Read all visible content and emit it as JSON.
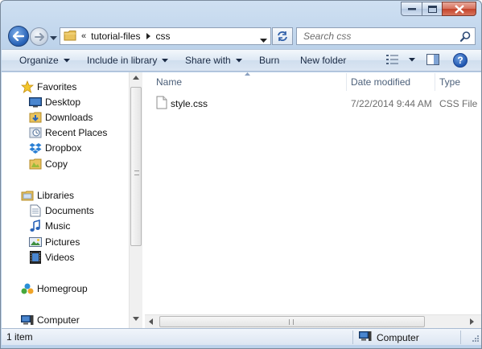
{
  "window": {
    "caption_buttons": [
      "minimize",
      "maximize",
      "close"
    ]
  },
  "address_bar": {
    "overflow": "«",
    "segments": [
      "tutorial-files",
      "css"
    ]
  },
  "search": {
    "placeholder": "Search css"
  },
  "toolbar": {
    "organize": "Organize",
    "include_in_library": "Include in library",
    "share_with": "Share with",
    "burn": "Burn",
    "new_folder": "New folder"
  },
  "navigation": {
    "favorites": {
      "label": "Favorites",
      "items": [
        "Desktop",
        "Downloads",
        "Recent Places",
        "Dropbox",
        "Copy"
      ]
    },
    "libraries": {
      "label": "Libraries",
      "items": [
        "Documents",
        "Music",
        "Pictures",
        "Videos"
      ]
    },
    "homegroup": "Homegroup",
    "computer": "Computer"
  },
  "file_list": {
    "columns": [
      "Name",
      "Date modified",
      "Type"
    ],
    "files": [
      {
        "name": "style.css",
        "date_modified": "7/22/2014 9:44 AM",
        "type": "CSS File"
      }
    ]
  },
  "status_bar": {
    "item_count": "1 item",
    "location": "Computer"
  },
  "colors": {
    "chrome": "#bcd2ea",
    "accent": "#2a64b8",
    "column_header_text": "#4c607a",
    "secondary_text": "#6d6d6d"
  }
}
